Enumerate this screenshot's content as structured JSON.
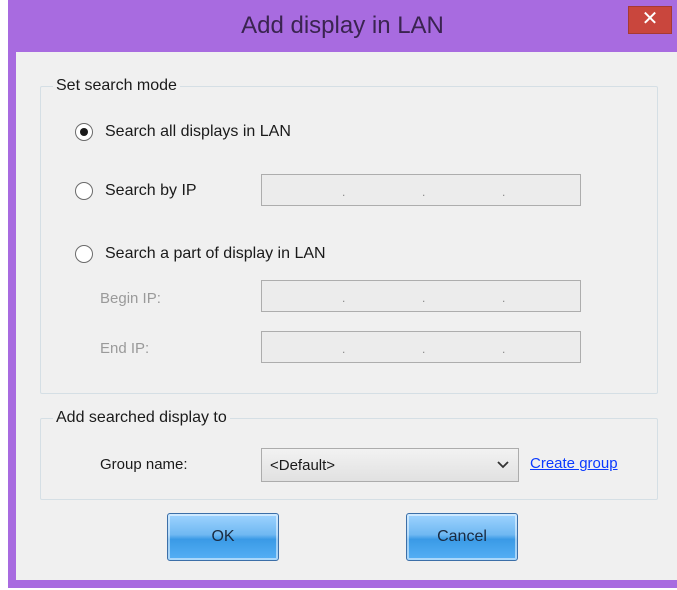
{
  "window": {
    "title": "Add display in LAN",
    "close_glyph": "✕",
    "accent": "#a86be0"
  },
  "search_mode": {
    "legend": "Set search mode",
    "options": [
      {
        "label": "Search all displays in LAN",
        "checked": true
      },
      {
        "label": "Search by IP",
        "checked": false
      },
      {
        "label": "Search a part of display in LAN",
        "checked": false
      }
    ],
    "begin_ip_label": "Begin IP:",
    "end_ip_label": "End IP:",
    "ip_separator": "."
  },
  "add_to": {
    "legend": "Add searched display to",
    "group_name_label": "Group name:",
    "group_value": "<Default>",
    "create_group_link": "Create group"
  },
  "buttons": {
    "ok": "OK",
    "cancel": "Cancel"
  }
}
